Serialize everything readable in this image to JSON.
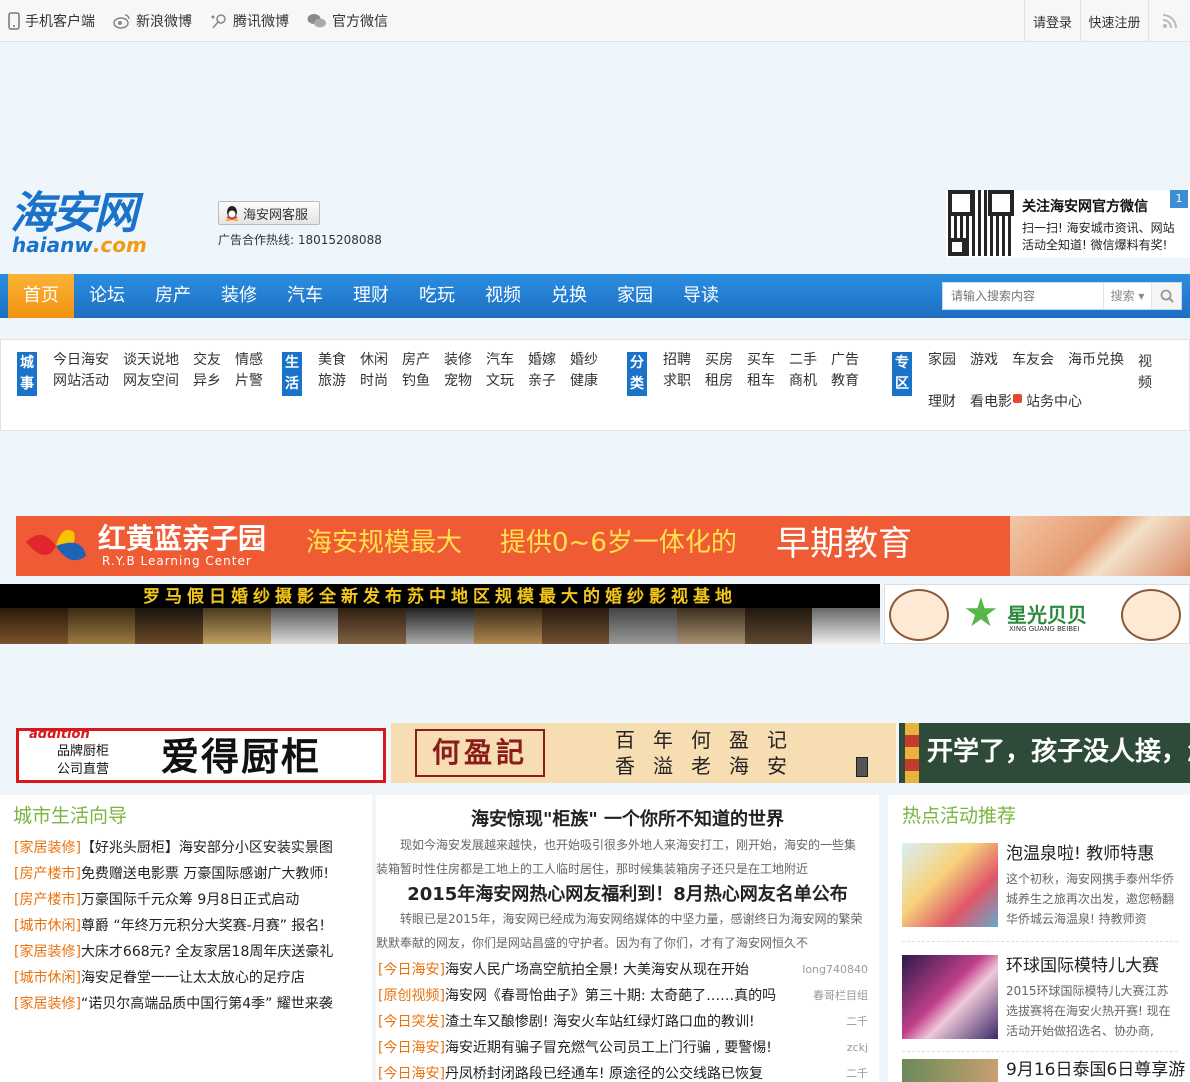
{
  "topbar": {
    "left": [
      {
        "label": "手机客户端",
        "icon": "phone-icon"
      },
      {
        "label": "新浪微博",
        "icon": "weibo-icon"
      },
      {
        "label": "腾讯微博",
        "icon": "tencent-weibo-icon"
      },
      {
        "label": "官方微信",
        "icon": "wechat-icon"
      }
    ],
    "login": "请登录",
    "register": "快速注册",
    "rss_icon": "rss-icon"
  },
  "header": {
    "logo_cn": "海安网",
    "logo_en_main": "haianw",
    "logo_en_tld": ".com",
    "kefu_label": "海安网客服",
    "hotline": "广告合作热线: 18015208088",
    "wechat_title": "关注海安网官方微信",
    "wechat_desc": "扫一扫! 海安城市资讯、网站活动全知道! 微信爆料有奖!",
    "wechat_badge": "1"
  },
  "nav": {
    "items": [
      "首页",
      "论坛",
      "房产",
      "装修",
      "汽车",
      "理财",
      "吃玩",
      "视频",
      "兑换",
      "家园",
      "导读"
    ],
    "search_placeholder": "请输入搜索内容",
    "search_select": "搜索"
  },
  "subnav": {
    "groups": [
      {
        "label": "城事",
        "links": [
          "今日海安",
          "谈天说地",
          "交友",
          "情感",
          "网站活动",
          "网友空间",
          "异乡",
          "片警"
        ]
      },
      {
        "label": "生活",
        "links": [
          "美食",
          "休闲",
          "房产",
          "装修",
          "汽车",
          "婚嫁",
          "婚纱",
          "旅游",
          "时尚",
          "钓鱼",
          "宠物",
          "文玩",
          "亲子",
          "健康"
        ]
      },
      {
        "label": "分类",
        "links": [
          "招聘",
          "买房",
          "买车",
          "二手",
          "广告",
          "求职",
          "租房",
          "租车",
          "商机",
          "教育"
        ]
      },
      {
        "label": "专区",
        "links": [
          "家园",
          "游戏",
          "车友会",
          "海币兑换",
          "视频",
          "理财",
          "看电影",
          "站务中心"
        ]
      }
    ]
  },
  "ads": {
    "ryb_name": "红黄蓝亲子园",
    "ryb_en": "R.Y.B Learning Center",
    "ryb_s1": "海安规模最大",
    "ryb_s2": "提供0~6岁一体化的",
    "ryb_s3": "早期教育",
    "wedding": "罗马假日婚纱摄影全新发布苏中地区规模最大的婚纱影视基地",
    "xingguang": "星光贝贝",
    "xingguang_en": "XING GUANG BEIBEI",
    "addition_brand": "addition",
    "addition_sub1": "品牌厨柜",
    "addition_sub2": "公司直营",
    "addition_name": "爱得厨柜",
    "heying": "何盈記",
    "heying_poem_1": "百年何盈记",
    "heying_poem_2": "香溢老海安",
    "school": "开学了，孩子没人接，怎么办?"
  },
  "guide": {
    "title": "城市生活向导",
    "items": [
      {
        "tag": "[家居装修]",
        "text": "【好兆头厨柜】海安部分小区安装实景图"
      },
      {
        "tag": "[房产楼市]",
        "text": "免费赠送电影票 万豪国际感谢广大教师!"
      },
      {
        "tag": "[房产楼市]",
        "text": "万豪国际千元众筹 9月8日正式启动"
      },
      {
        "tag": "[城市休闲]",
        "text": "尊爵 “年终万元积分大奖赛-月赛” 报名!"
      },
      {
        "tag": "[家居装修]",
        "text": "大床才668元? 全友家居18周年庆送豪礼"
      },
      {
        "tag": "[城市休闲]",
        "text": "海安足眷堂一一让太太放心的足疗店"
      },
      {
        "tag": "[家居装修]",
        "text": "“诺贝尔高端品质中国行第4季” 耀世来袭"
      }
    ]
  },
  "headlines": {
    "h1": "海安惊现\"柜族\" 一个你所不知道的世界",
    "s1": "现如今海安发展越来越快，也开始吸引很多外地人来海安打工，刚开始，海安的一些集装箱暂时性住房都是工地上的工人临时居住，那时候集装箱房子还只是在工地附近",
    "h2": "2015年海安网热心网友福利到！8月热心网友名单公布",
    "s2": "转眼已是2015年，海安网已经成为海安网络媒体的中坚力量，感谢终日为海安网的繁荣默默奉献的网友，你们是网站昌盛的守护者。因为有了你们，才有了海安网恒久不",
    "items": [
      {
        "tag": "[今日海安]",
        "text": "海安人民广场高空航拍全景! 大美海安从现在开始",
        "author": "long740840"
      },
      {
        "tag": "[原创视频]",
        "text": "海安网《春哥怡曲子》第三十期: 太奇葩了……真的吗",
        "author": "春哥栏目组"
      },
      {
        "tag": "[今日突发]",
        "text": "渣土车又酿惨剧! 海安火车站红绿灯路口血的教训!",
        "author": "二千"
      },
      {
        "tag": "[今日海安]",
        "text": "海安近期有骗子冒充燃气公司员工上门行骗 , 要警惕!",
        "author": "zckj"
      },
      {
        "tag": "[今日海安]",
        "text": "丹凤桥封闭路段已经通车! 原途径的公交线路已恢复",
        "author": "二千"
      }
    ]
  },
  "events": {
    "title": "热点活动推荐",
    "items": [
      {
        "title": "泡温泉啦! 教师特惠",
        "desc": "这个初秋，海安网携手泰州华侨城养生之旅再次出发，邀您畅翻华侨城云海温泉! 持教师资"
      },
      {
        "title": "环球国际模特儿大赛",
        "desc": "2015环球国际模特儿大赛江苏选拔赛将在海安火热开赛! 现在活动开始做招选名、协办商,"
      },
      {
        "title": "9月16日泰国6日尊享游",
        "desc": ""
      }
    ]
  }
}
